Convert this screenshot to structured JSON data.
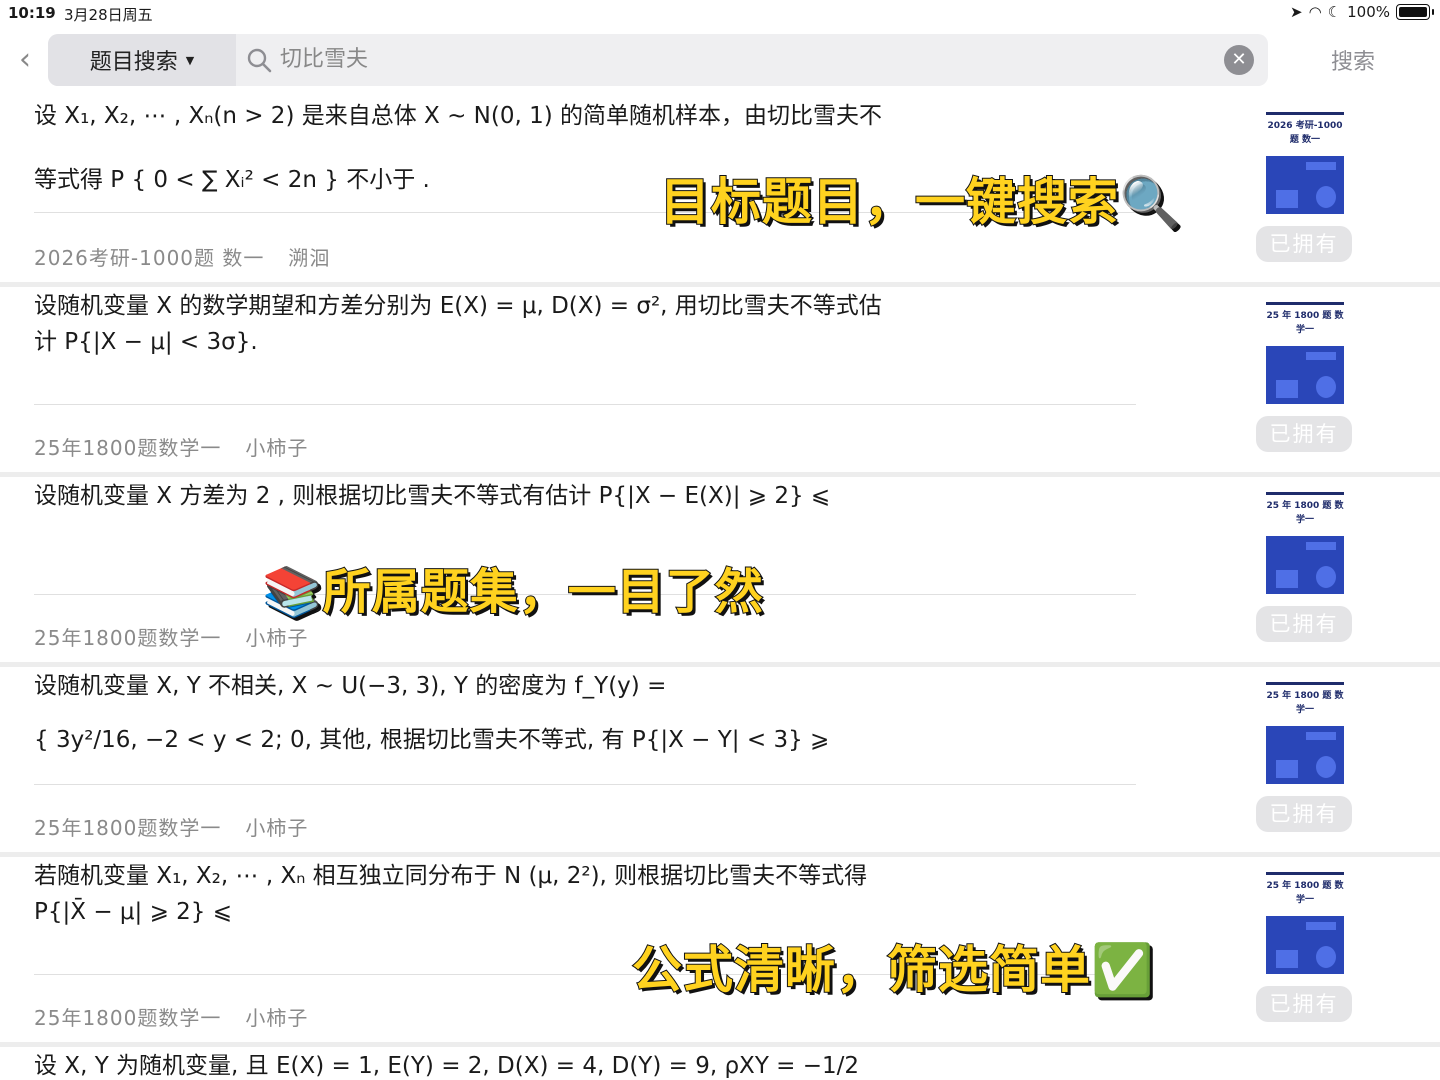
{
  "status": {
    "time": "10:19",
    "date": "3月28日周五",
    "battery": "100%"
  },
  "nav": {
    "scope_label": "题目搜索",
    "query": "切比雪夫",
    "search_button": "搜索"
  },
  "overlays": {
    "top": "目标题目，一键搜索🔍",
    "middle": "📚所属题集，一目了然",
    "bottom": "公式清晰，筛选简单✅"
  },
  "results": [
    {
      "line1": "设 X₁, X₂, ⋯ , Xₙ(n > 2) 是来自总体 X ∼ N(0, 1) 的简单随机样本，由切比雪夫不",
      "line2": "等式得 P { 0 < ∑ Xᵢ² < 2n } 不小于              .",
      "source": "2026考研-1000题 数一",
      "author": "溯洄",
      "book_title": "2026 考研-1000 题 数一",
      "owned": "已拥有"
    },
    {
      "line1": "设随机变量 X 的数学期望和方差分别为 E(X) = μ, D(X) = σ², 用切比雪夫不等式估",
      "line2": "计 P{|X − μ| < 3σ}.",
      "source": "25年1800题数学一",
      "author": "小柿子",
      "book_title": "25 年 1800 题 数学一",
      "owned": "已拥有"
    },
    {
      "line1": "设随机变量 X 方差为 2 , 则根据切比雪夫不等式有估计 P{|X − E(X)| ⩾ 2} ⩽",
      "line2": "",
      "source": "25年1800题数学一",
      "author": "小柿子",
      "book_title": "25 年 1800 题 数学一",
      "owned": "已拥有"
    },
    {
      "line1": "设随机变量 X, Y 不相关, X ∼ U(−3, 3), Y 的密度为 f_Y(y) =",
      "line2": "{ 3y²/16,  −2 < y < 2;  0,  其他,    根据切比雪夫不等式, 有 P{|X − Y| < 3} ⩾",
      "source": "25年1800题数学一",
      "author": "小柿子",
      "book_title": "25 年 1800 题 数学一",
      "owned": "已拥有"
    },
    {
      "line1": "若随机变量 X₁, X₂, ⋯ , Xₙ 相互独立同分布于 N (μ, 2²), 则根据切比雪夫不等式得",
      "line2": "P{|X̄ − μ| ⩾ 2} ⩽",
      "source": "25年1800题数学一",
      "author": "小柿子",
      "book_title": "25 年 1800 题 数学一",
      "owned": "已拥有"
    },
    {
      "line1": "设 X, Y 为随机变量, 且 E(X) = 1, E(Y) = 2, D(X) = 4, D(Y) = 9, ρXY = −1/2",
      "line2": "",
      "source": "",
      "author": "",
      "book_title": "",
      "owned": ""
    }
  ],
  "colors": {
    "accent_overlay": "#ffd21f",
    "owned_bg": "#e4e4e6",
    "book_blue": "#2a46b8"
  }
}
